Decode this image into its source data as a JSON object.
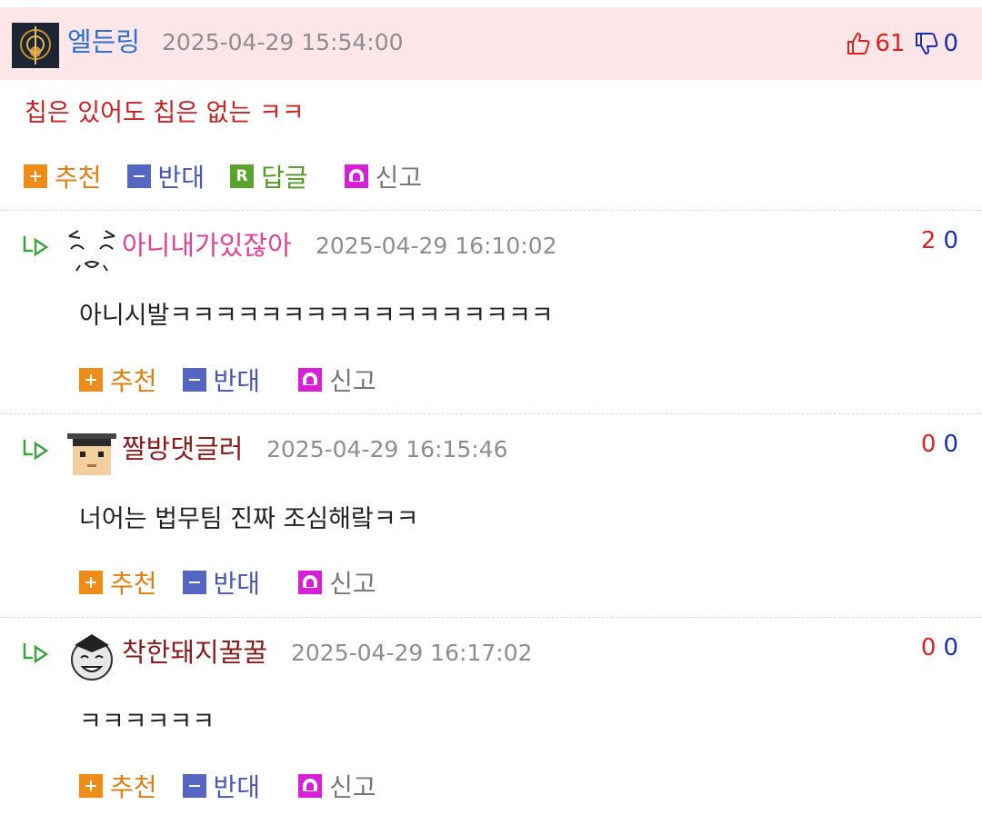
{
  "comments": [
    {
      "nick": "엘든링",
      "date": "2025-04-29 15:54:00",
      "up": "61",
      "down": "0",
      "text": "칩은 있어도 칩은 없는 ㅋㅋ",
      "actions": {
        "recommend": "추천",
        "oppose": "반대",
        "reply": "답글",
        "report": "신고"
      }
    },
    {
      "nick": "아니내가있잖아",
      "date": "2025-04-29 16:10:02",
      "up": "2",
      "down": "0",
      "text": "아니시발ㅋㅋㅋㅋㅋㅋㅋㅋㅋㅋㅋㅋㅋㅋㅋㅋㅋ",
      "actions": {
        "recommend": "추천",
        "oppose": "반대",
        "report": "신고"
      }
    },
    {
      "nick": "짤방댓글러",
      "date": "2025-04-29 16:15:46",
      "up": "0",
      "down": "0",
      "text": "너어는 법무팀 진짜 조심해랔ㅋㅋ",
      "actions": {
        "recommend": "추천",
        "oppose": "반대",
        "report": "신고"
      }
    },
    {
      "nick": "착한돼지꿀꿀",
      "date": "2025-04-29 16:17:02",
      "up": "0",
      "down": "0",
      "text": "ㅋㅋㅋㅋㅋㅋ",
      "actions": {
        "recommend": "추천",
        "oppose": "반대",
        "report": "신고"
      }
    }
  ],
  "colors": {
    "header_bg": "#fde6e8",
    "nick_blue": "#2a6fd6",
    "nick_pink": "#e0419a",
    "nick_dark": "#8b1a1a",
    "comment_red": "#cc2222",
    "vote_up": "#dd2222",
    "vote_down": "#1a2db3"
  }
}
